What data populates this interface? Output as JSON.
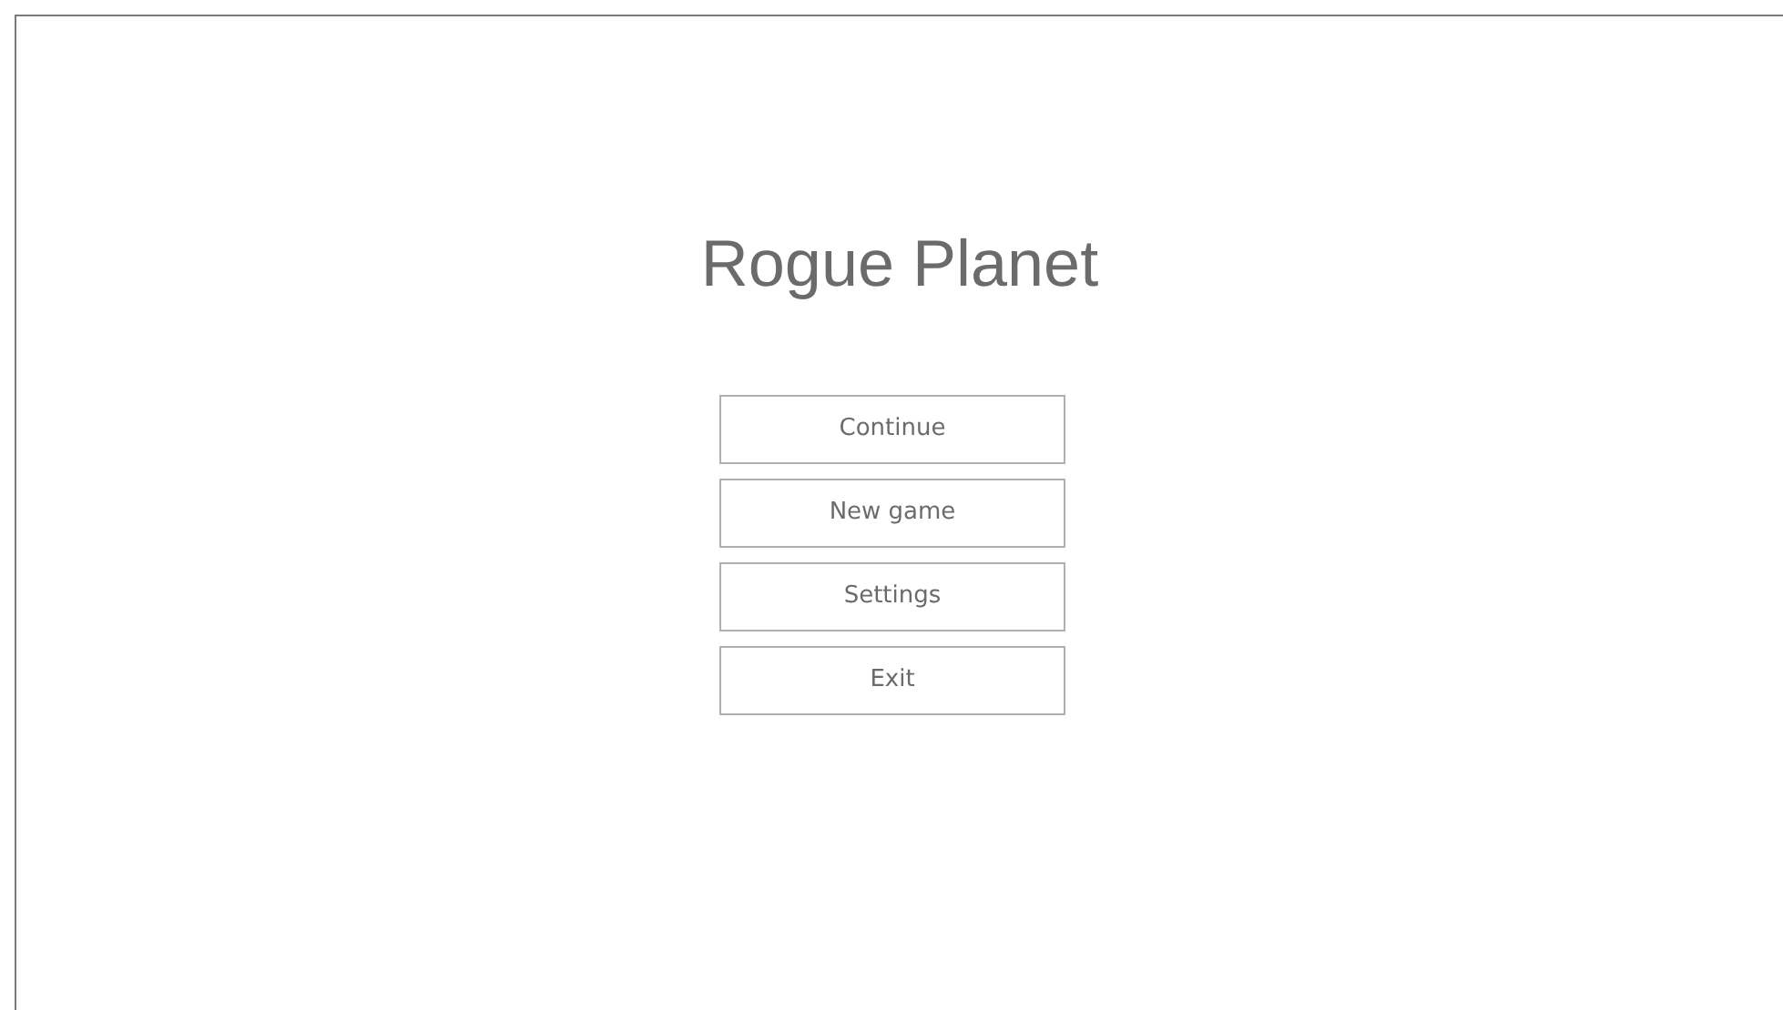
{
  "title": "Rogue Planet",
  "menu": [
    {
      "label": "Continue"
    },
    {
      "label": "New game"
    },
    {
      "label": "Settings"
    },
    {
      "label": "Exit"
    }
  ]
}
